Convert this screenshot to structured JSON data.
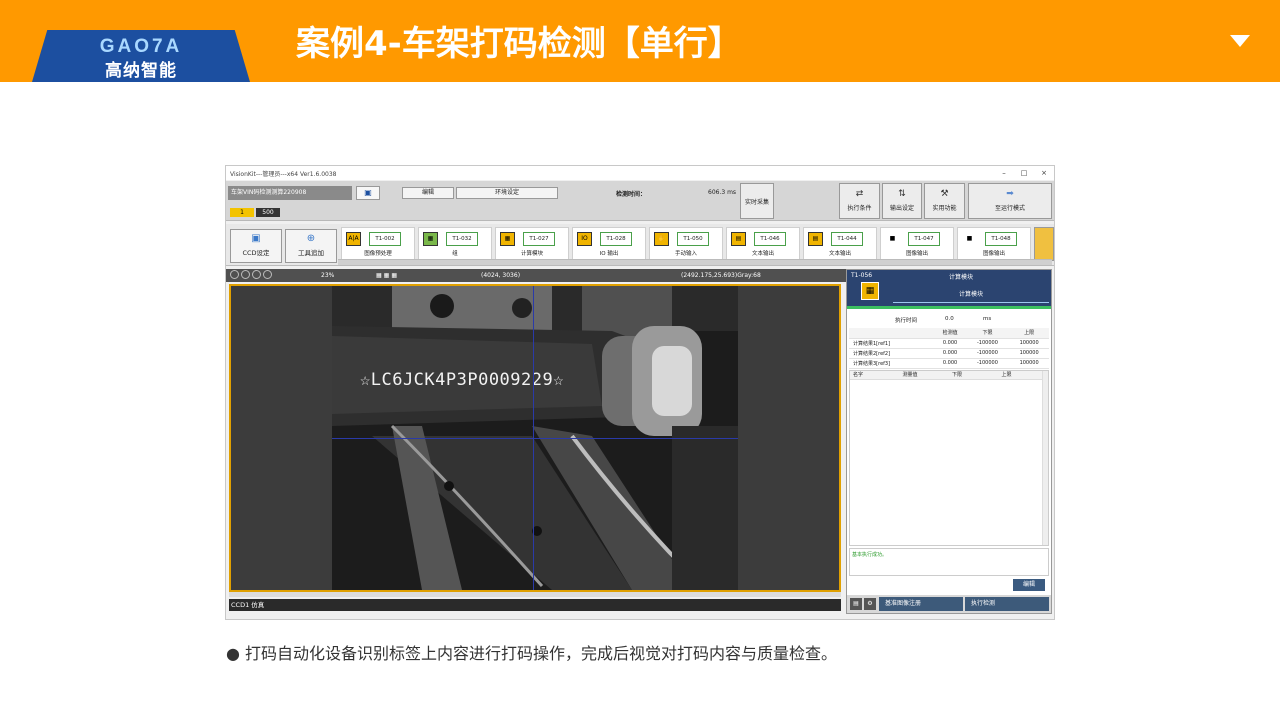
{
  "header": {
    "logo_en": "GAO7A",
    "logo_cn": "高纳智能",
    "title": "案例4-车架打码检测【单行】"
  },
  "app": {
    "window_title": "VisionKit---管理员---x64 Ver1.6.0038",
    "window_controls": [
      "–",
      "□",
      "×"
    ],
    "project": "车架VIN码检测测算220908",
    "tab_badge": "1",
    "tab_count": "500",
    "menu_edit": "编辑",
    "menu_env": "环境设定",
    "detect_time_label": "检测时间：",
    "detect_time_value": "606.3 ms",
    "btn_live": "实时采集",
    "btn_exec_cond": "执行条件",
    "btn_output_set": "输出设定",
    "btn_util": "实用功能",
    "btn_run_mode": "至运行模式",
    "btn_ccd": "CCD设定",
    "btn_tool_add": "工具追加",
    "tools": [
      {
        "icon": "A|A",
        "id": "T1-002",
        "name": "图像预处理"
      },
      {
        "icon": "▦",
        "id": "T1-032",
        "name": "组"
      },
      {
        "icon": "▦",
        "id": "T1-027",
        "name": "计算模块"
      },
      {
        "icon": "IO",
        "id": "T1-028",
        "name": "IO 输出"
      },
      {
        "icon": "✋",
        "id": "T1-050",
        "name": "手动输入"
      },
      {
        "icon": "▤",
        "id": "T1-046",
        "name": "文本输出"
      },
      {
        "icon": "▤",
        "id": "T1-044",
        "name": "文本输出"
      },
      {
        "icon": "■",
        "id": "T1-047",
        "name": "图像输出"
      },
      {
        "icon": "■",
        "id": "T1-048",
        "name": "图像输出"
      }
    ],
    "zoom": "23%",
    "image_size": "(4024, 3036)",
    "cursor_info": "(2492.175,25.693)Gray:68",
    "vin_text": "☆LC6JCK4P3P0009229☆",
    "ccd_label": "CCD1 仿真",
    "panel": {
      "tool_id": "T1-056",
      "tool_name": "计算模块",
      "sub_name": "计算模块",
      "exec_time_label": "执行时间",
      "exec_time_value": "0.0",
      "exec_time_unit": "ms",
      "headers": [
        "",
        "检测值",
        "下限",
        "上限"
      ],
      "rows": [
        [
          "计算结果1[ref1]",
          "0.000",
          "-100000",
          "100000"
        ],
        [
          "计算结果2[ref2]",
          "0.000",
          "-100000",
          "100000"
        ],
        [
          "计算结果3[ref3]",
          "0.000",
          "-100000",
          "100000"
        ]
      ],
      "list_headers": [
        "名字",
        "测量值",
        "下限",
        "上限"
      ],
      "log": "基本执行成功。",
      "edit_label": "编辑",
      "btn_ref_register": "基准图像注册",
      "btn_exec_detect": "执行检测"
    }
  },
  "bullet": "● 打码自动化设备识别标签上内容进行打码操作，完成后视觉对打码内容与质量检查。"
}
